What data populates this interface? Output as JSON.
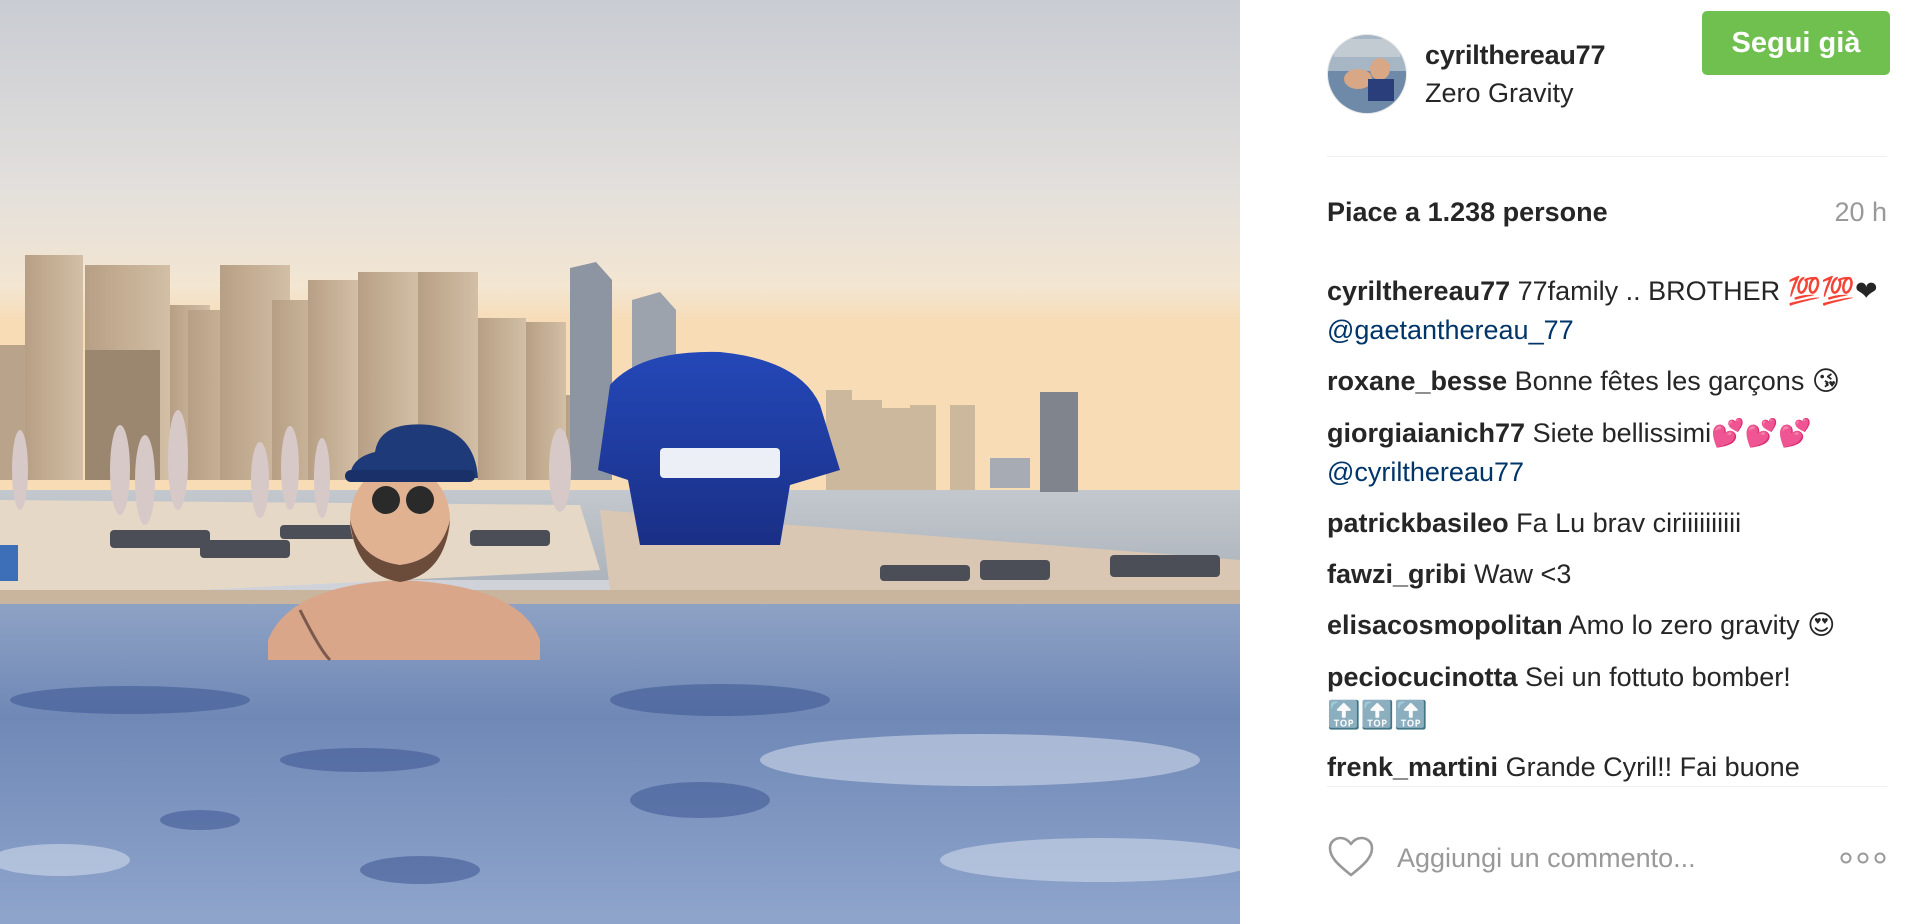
{
  "post": {
    "photo_alt": "two men in infinity pool with city skyline"
  },
  "header": {
    "username": "cyrilthereau77",
    "location": "Zero Gravity",
    "follow_label": "Segui già"
  },
  "stats": {
    "likes_text": "Piace a 1.238 persone",
    "time_text": "20 h"
  },
  "comments": [
    {
      "author": "cyrilthereau77",
      "text": "77family .. BROTHER",
      "emoji": "💯💯❤",
      "mention": "@gaetanthereau_77"
    },
    {
      "author": "roxane_besse",
      "text": "Bonne fêtes les garçons",
      "emoji": "😘"
    },
    {
      "author": "giorgiaianich77",
      "text": "Siete bellissimi",
      "emoji": "💕💕💕",
      "mention": "@cyrilthereau77"
    },
    {
      "author": "patrickbasileo",
      "text": "Fa Lu brav ciriiiiiiiiii"
    },
    {
      "author": "fawzi_gribi",
      "text": "Waw <3"
    },
    {
      "author": "elisacosmopolitan",
      "text": "Amo lo zero gravity",
      "emoji": "😍"
    },
    {
      "author": "peciocucinotta",
      "text": "Sei un fottuto bomber!",
      "emoji": "🔝🔝🔝"
    },
    {
      "author": "frenk_martini",
      "text": "Grande Cyril!! Fai buone"
    }
  ],
  "footer": {
    "comment_placeholder": "Aggiungi un commento..."
  },
  "icons": {
    "like": "heart-outline-icon",
    "more": "three-dots-icon"
  },
  "colors": {
    "follow_bg": "#70c050",
    "mention": "#003569",
    "muted": "#999999"
  }
}
